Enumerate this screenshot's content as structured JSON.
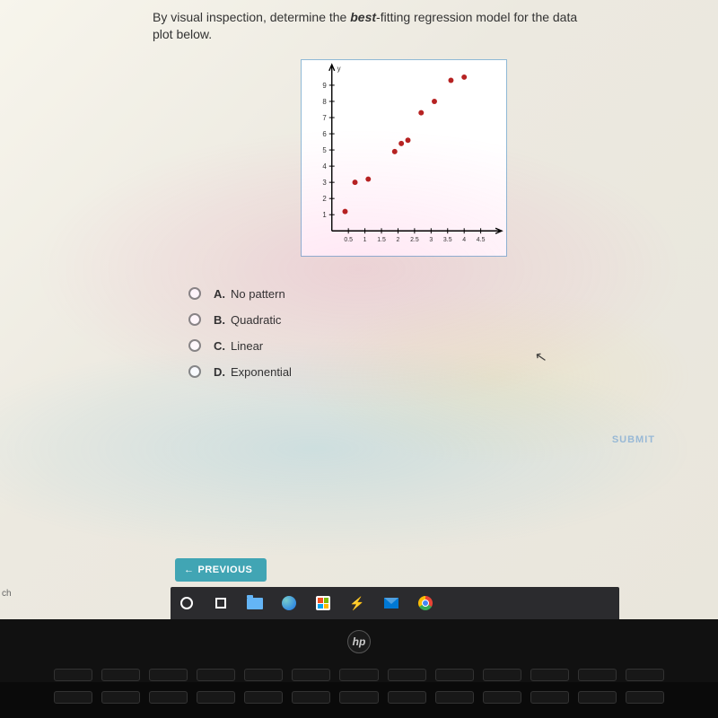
{
  "question": {
    "prefix": "By visual inspection, determine the ",
    "bold_word": "best",
    "suffix_1": "-fitting regression model for the data",
    "suffix_2": "plot below."
  },
  "options": [
    {
      "letter": "A.",
      "text": "No pattern"
    },
    {
      "letter": "B.",
      "text": "Quadratic"
    },
    {
      "letter": "C.",
      "text": "Linear"
    },
    {
      "letter": "D.",
      "text": "Exponential"
    }
  ],
  "submit_label": "SUBMIT",
  "previous_label": "PREVIOUS",
  "edge_label": "ch",
  "hp_label": "hp",
  "chart_data": {
    "type": "scatter",
    "x_ticks": [
      "0.5",
      "1",
      "1.5",
      "2",
      "2.5",
      "3",
      "3.5",
      "4",
      "4.5"
    ],
    "y_ticks": [
      "1",
      "2",
      "3",
      "4",
      "5",
      "6",
      "7",
      "8",
      "9"
    ],
    "axis_labels": {
      "x": "",
      "y": "y"
    },
    "points": [
      {
        "x": 0.4,
        "y": 1.2
      },
      {
        "x": 0.7,
        "y": 3.0
      },
      {
        "x": 1.1,
        "y": 3.2
      },
      {
        "x": 1.9,
        "y": 4.9
      },
      {
        "x": 2.1,
        "y": 5.4
      },
      {
        "x": 2.3,
        "y": 5.6
      },
      {
        "x": 2.7,
        "y": 7.3
      },
      {
        "x": 3.1,
        "y": 8.0
      },
      {
        "x": 3.6,
        "y": 9.3
      },
      {
        "x": 4.0,
        "y": 9.5
      }
    ],
    "x_range": [
      0,
      5
    ],
    "y_range": [
      0,
      10
    ]
  }
}
